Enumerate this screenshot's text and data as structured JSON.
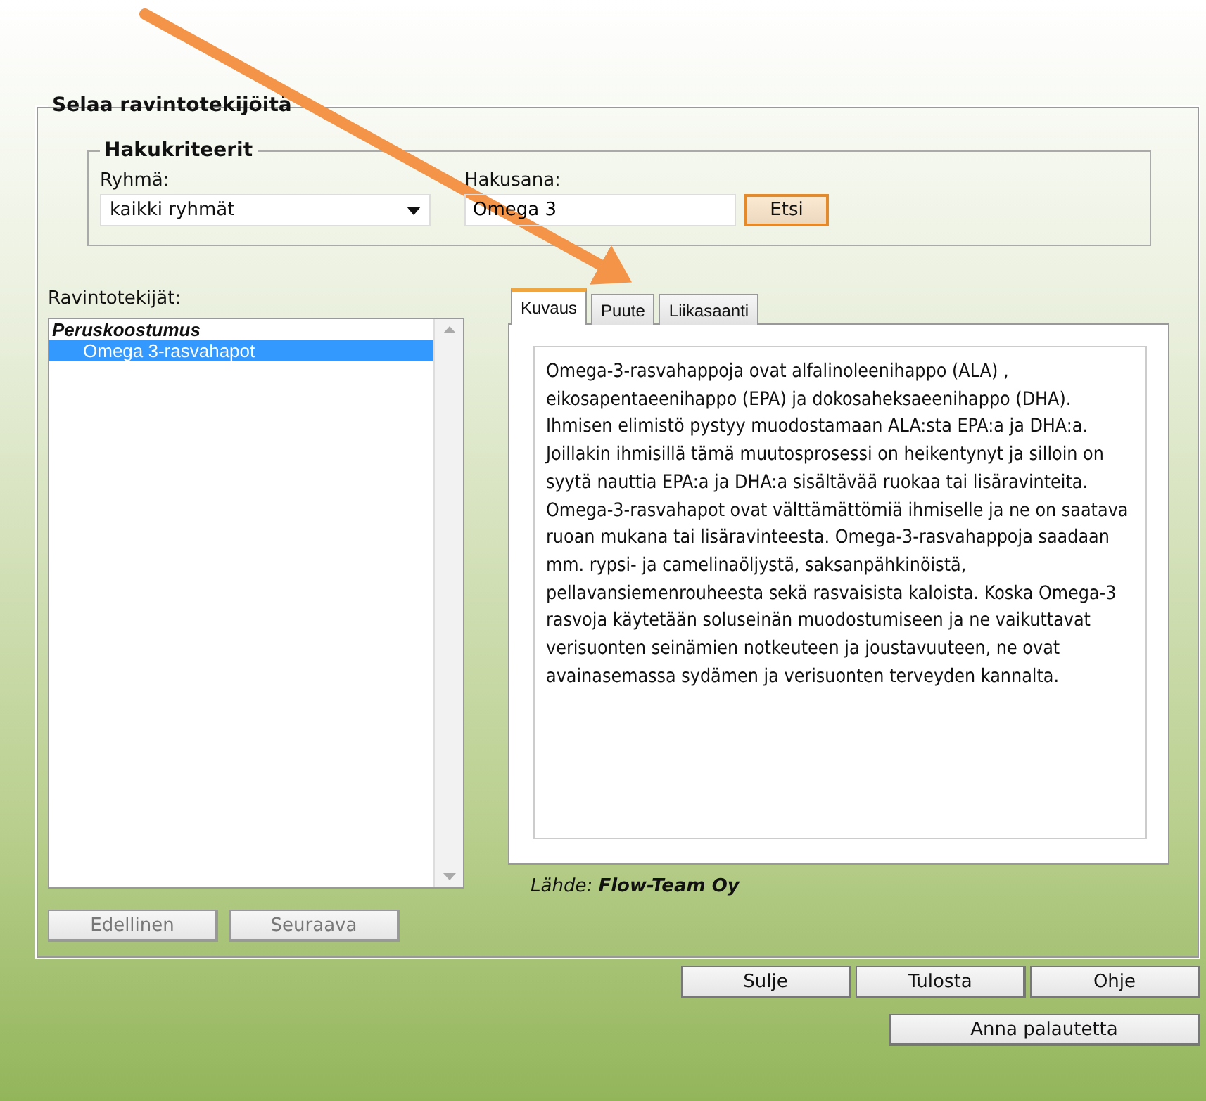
{
  "window": {
    "title": "Selaa ravintotekijöitä"
  },
  "search_criteria": {
    "title": "Hakukriteerit",
    "group_label": "Ryhmä:",
    "group_value": "kaikki ryhmät",
    "search_label": "Hakusana:",
    "search_value": "Omega 3",
    "search_button": "Etsi"
  },
  "nutrients": {
    "label": "Ravintotekijät:",
    "groups": [
      {
        "name": "Peruskoostumus",
        "items": [
          {
            "name": "Omega 3-rasvahapot",
            "selected": true
          }
        ]
      }
    ]
  },
  "tabs": [
    {
      "label": "Kuvaus",
      "selected": true
    },
    {
      "label": "Puute",
      "selected": false
    },
    {
      "label": "Liikasaanti",
      "selected": false
    }
  ],
  "description": "Omega-3-rasvahappoja ovat alfalinoleenihappo (ALA) , eikosapentaeenihappo (EPA) ja dokosaheksaeenihappo (DHA). Ihmisen elimistö pystyy muodostamaan ALA:sta EPA:a ja DHA:a. Joillakin ihmisillä tämä muutosprosessi on heikentynyt ja silloin on syytä nauttia EPA:a ja DHA:a sisältävää ruokaa tai lisäravinteita. Omega-3-rasvahapot ovat välttämättömiä ihmiselle ja ne on saatava ruoan mukana tai lisäravinteesta. Omega-3-rasvahappoja saadaan mm. rypsi- ja camelinaöljystä, saksanpähkinöistä, pellavansiemenrouheesta sekä rasvaisista kaloista. Koska Omega-3 rasvoja käytetään soluseinän muodostumiseen ja ne vaikuttavat verisuonten seinämien notkeuteen ja joustavuuteen, ne ovat avainasemassa sydämen ja verisuonten terveyden kannalta.",
  "source": "Lähde: **Flow-Team Oy**",
  "nav_buttons": [
    {
      "label": "Edellinen",
      "disabled": true
    },
    {
      "label": "Seuraava",
      "disabled": true
    }
  ],
  "buttons": [
    "Sulje",
    "Tulosta",
    "Ohje"
  ],
  "feedback_button": "Anna palautetta"
}
